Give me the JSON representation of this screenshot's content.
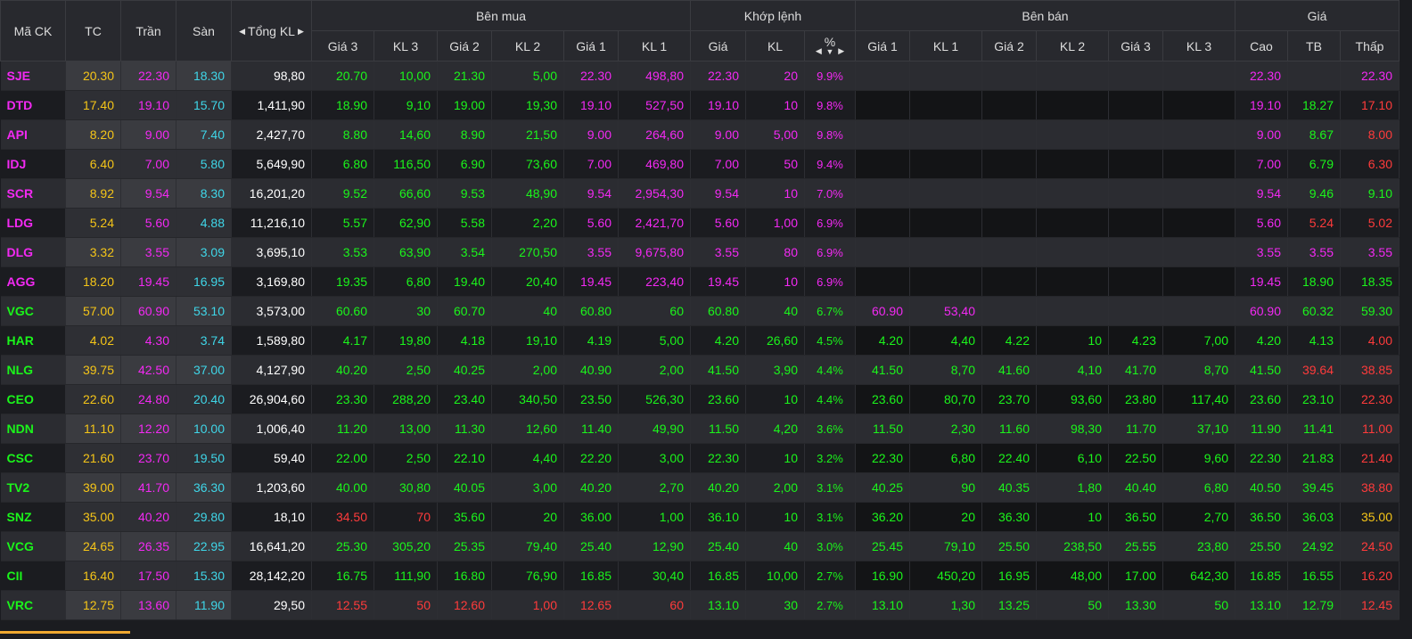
{
  "header": {
    "symbol": "Mã CK",
    "ref": "TC",
    "ceil": "Trần",
    "floor": "Sàn",
    "total_vol": "Tổng KL",
    "groups": {
      "bid": "Bên mua",
      "match": "Khớp lệnh",
      "ask": "Bên bán",
      "price": "Giá"
    },
    "bid_cols": [
      "Giá 3",
      "KL 3",
      "Giá 2",
      "KL 2",
      "Giá 1",
      "KL 1"
    ],
    "match_cols": [
      "Giá",
      "KL",
      "%"
    ],
    "ask_cols": [
      "Giá 1",
      "KL 1",
      "Giá 2",
      "KL 2",
      "Giá 3",
      "KL 3"
    ],
    "price_cols": [
      "Cao",
      "TB",
      "Thấp"
    ]
  },
  "colors": {
    "ref": "#f5c518",
    "ceil": "#f329f3",
    "floor": "#3fd6e8",
    "up": "#1bf51b",
    "down": "#ff3b3b",
    "white": "#ffffff"
  },
  "rows": [
    {
      "sym": "SJE",
      "sc": "ceil",
      "ref": "20.30",
      "ceil": "22.30",
      "floor": "18.30",
      "tot": "98,80",
      "b3": "20.70",
      "b3v": "10,00",
      "b3c": "up",
      "b2": "21.30",
      "b2v": "5,00",
      "b2c": "up",
      "b1": "22.30",
      "b1v": "498,80",
      "b1c": "ceil",
      "mp": "22.30",
      "mv": "20",
      "mpct": "9.9%",
      "mc": "ceil",
      "a1": "",
      "a1v": "",
      "a1c": "up",
      "a2": "",
      "a2v": "",
      "a2c": "up",
      "a3": "",
      "a3v": "",
      "a3c": "up",
      "hi": "22.30",
      "hic": "ceil",
      "avg": "",
      "avgc": "up",
      "lo": "22.30",
      "loc": "ceil"
    },
    {
      "sym": "DTD",
      "sc": "ceil",
      "ref": "17.40",
      "ceil": "19.10",
      "floor": "15.70",
      "tot": "1,411,90",
      "b3": "18.90",
      "b3v": "9,10",
      "b3c": "up",
      "b2": "19.00",
      "b2v": "19,30",
      "b2c": "up",
      "b1": "19.10",
      "b1v": "527,50",
      "b1c": "ceil",
      "mp": "19.10",
      "mv": "10",
      "mpct": "9.8%",
      "mc": "ceil",
      "a1": "",
      "a1v": "",
      "a1c": "up",
      "a2": "",
      "a2v": "",
      "a2c": "up",
      "a3": "",
      "a3v": "",
      "a3c": "up",
      "hi": "19.10",
      "hic": "ceil",
      "avg": "18.27",
      "avgc": "up",
      "lo": "17.10",
      "loc": "down"
    },
    {
      "sym": "API",
      "sc": "ceil",
      "ref": "8.20",
      "ceil": "9.00",
      "floor": "7.40",
      "tot": "2,427,70",
      "b3": "8.80",
      "b3v": "14,60",
      "b3c": "up",
      "b2": "8.90",
      "b2v": "21,50",
      "b2c": "up",
      "b1": "9.00",
      "b1v": "264,60",
      "b1c": "ceil",
      "mp": "9.00",
      "mv": "5,00",
      "mpct": "9.8%",
      "mc": "ceil",
      "a1": "",
      "a1v": "",
      "a1c": "up",
      "a2": "",
      "a2v": "",
      "a2c": "up",
      "a3": "",
      "a3v": "",
      "a3c": "up",
      "hi": "9.00",
      "hic": "ceil",
      "avg": "8.67",
      "avgc": "up",
      "lo": "8.00",
      "loc": "down"
    },
    {
      "sym": "IDJ",
      "sc": "ceil",
      "ref": "6.40",
      "ceil": "7.00",
      "floor": "5.80",
      "tot": "5,649,90",
      "b3": "6.80",
      "b3v": "116,50",
      "b3c": "up",
      "b2": "6.90",
      "b2v": "73,60",
      "b2c": "up",
      "b1": "7.00",
      "b1v": "469,80",
      "b1c": "ceil",
      "mp": "7.00",
      "mv": "50",
      "mpct": "9.4%",
      "mc": "ceil",
      "a1": "",
      "a1v": "",
      "a1c": "up",
      "a2": "",
      "a2v": "",
      "a2c": "up",
      "a3": "",
      "a3v": "",
      "a3c": "up",
      "hi": "7.00",
      "hic": "ceil",
      "avg": "6.79",
      "avgc": "up",
      "lo": "6.30",
      "loc": "down"
    },
    {
      "sym": "SCR",
      "sc": "ceil",
      "ref": "8.92",
      "ceil": "9.54",
      "floor": "8.30",
      "tot": "16,201,20",
      "b3": "9.52",
      "b3v": "66,60",
      "b3c": "up",
      "b2": "9.53",
      "b2v": "48,90",
      "b2c": "up",
      "b1": "9.54",
      "b1v": "2,954,30",
      "b1c": "ceil",
      "mp": "9.54",
      "mv": "10",
      "mpct": "7.0%",
      "mc": "ceil",
      "a1": "",
      "a1v": "",
      "a1c": "up",
      "a2": "",
      "a2v": "",
      "a2c": "up",
      "a3": "",
      "a3v": "",
      "a3c": "up",
      "hi": "9.54",
      "hic": "ceil",
      "avg": "9.46",
      "avgc": "up",
      "lo": "9.10",
      "loc": "up"
    },
    {
      "sym": "LDG",
      "sc": "ceil",
      "ref": "5.24",
      "ceil": "5.60",
      "floor": "4.88",
      "tot": "11,216,10",
      "b3": "5.57",
      "b3v": "62,90",
      "b3c": "up",
      "b2": "5.58",
      "b2v": "2,20",
      "b2c": "up",
      "b1": "5.60",
      "b1v": "2,421,70",
      "b1c": "ceil",
      "mp": "5.60",
      "mv": "1,00",
      "mpct": "6.9%",
      "mc": "ceil",
      "a1": "",
      "a1v": "",
      "a1c": "up",
      "a2": "",
      "a2v": "",
      "a2c": "up",
      "a3": "",
      "a3v": "",
      "a3c": "up",
      "hi": "5.60",
      "hic": "ceil",
      "avg": "5.24",
      "avgc": "down",
      "lo": "5.02",
      "loc": "down"
    },
    {
      "sym": "DLG",
      "sc": "ceil",
      "ref": "3.32",
      "ceil": "3.55",
      "floor": "3.09",
      "tot": "3,695,10",
      "b3": "3.53",
      "b3v": "63,90",
      "b3c": "up",
      "b2": "3.54",
      "b2v": "270,50",
      "b2c": "up",
      "b1": "3.55",
      "b1v": "9,675,80",
      "b1c": "ceil",
      "mp": "3.55",
      "mv": "80",
      "mpct": "6.9%",
      "mc": "ceil",
      "a1": "",
      "a1v": "",
      "a1c": "up",
      "a2": "",
      "a2v": "",
      "a2c": "up",
      "a3": "",
      "a3v": "",
      "a3c": "up",
      "hi": "3.55",
      "hic": "ceil",
      "avg": "3.55",
      "avgc": "ceil",
      "lo": "3.55",
      "loc": "ceil"
    },
    {
      "sym": "AGG",
      "sc": "ceil",
      "ref": "18.20",
      "ceil": "19.45",
      "floor": "16.95",
      "tot": "3,169,80",
      "b3": "19.35",
      "b3v": "6,80",
      "b3c": "up",
      "b2": "19.40",
      "b2v": "20,40",
      "b2c": "up",
      "b1": "19.45",
      "b1v": "223,40",
      "b1c": "ceil",
      "mp": "19.45",
      "mv": "10",
      "mpct": "6.9%",
      "mc": "ceil",
      "a1": "",
      "a1v": "",
      "a1c": "up",
      "a2": "",
      "a2v": "",
      "a2c": "up",
      "a3": "",
      "a3v": "",
      "a3c": "up",
      "hi": "19.45",
      "hic": "ceil",
      "avg": "18.90",
      "avgc": "up",
      "lo": "18.35",
      "loc": "up"
    },
    {
      "sym": "VGC",
      "sc": "up",
      "ref": "57.00",
      "ceil": "60.90",
      "floor": "53.10",
      "tot": "3,573,00",
      "b3": "60.60",
      "b3v": "30",
      "b3c": "up",
      "b2": "60.70",
      "b2v": "40",
      "b2c": "up",
      "b1": "60.80",
      "b1v": "60",
      "b1c": "up",
      "mp": "60.80",
      "mv": "40",
      "mpct": "6.7%",
      "mc": "up",
      "a1": "60.90",
      "a1v": "53,40",
      "a1c": "ceil",
      "a2": "",
      "a2v": "",
      "a2c": "up",
      "a3": "",
      "a3v": "",
      "a3c": "up",
      "hi": "60.90",
      "hic": "ceil",
      "avg": "60.32",
      "avgc": "up",
      "lo": "59.30",
      "loc": "up"
    },
    {
      "sym": "HAR",
      "sc": "up",
      "ref": "4.02",
      "ceil": "4.30",
      "floor": "3.74",
      "tot": "1,589,80",
      "b3": "4.17",
      "b3v": "19,80",
      "b3c": "up",
      "b2": "4.18",
      "b2v": "19,10",
      "b2c": "up",
      "b1": "4.19",
      "b1v": "5,00",
      "b1c": "up",
      "mp": "4.20",
      "mv": "26,60",
      "mpct": "4.5%",
      "mc": "up",
      "a1": "4.20",
      "a1v": "4,40",
      "a1c": "up",
      "a2": "4.22",
      "a2v": "10",
      "a2c": "up",
      "a3": "4.23",
      "a3v": "7,00",
      "a3c": "up",
      "hi": "4.20",
      "hic": "up",
      "avg": "4.13",
      "avgc": "up",
      "lo": "4.00",
      "loc": "down"
    },
    {
      "sym": "NLG",
      "sc": "up",
      "ref": "39.75",
      "ceil": "42.50",
      "floor": "37.00",
      "tot": "4,127,90",
      "b3": "40.20",
      "b3v": "2,50",
      "b3c": "up",
      "b2": "40.25",
      "b2v": "2,00",
      "b2c": "up",
      "b1": "40.90",
      "b1v": "2,00",
      "b1c": "up",
      "mp": "41.50",
      "mv": "3,90",
      "mpct": "4.4%",
      "mc": "up",
      "a1": "41.50",
      "a1v": "8,70",
      "a1c": "up",
      "a2": "41.60",
      "a2v": "4,10",
      "a2c": "up",
      "a3": "41.70",
      "a3v": "8,70",
      "a3c": "up",
      "hi": "41.50",
      "hic": "up",
      "avg": "39.64",
      "avgc": "down",
      "lo": "38.85",
      "loc": "down"
    },
    {
      "sym": "CEO",
      "sc": "up",
      "ref": "22.60",
      "ceil": "24.80",
      "floor": "20.40",
      "tot": "26,904,60",
      "b3": "23.30",
      "b3v": "288,20",
      "b3c": "up",
      "b2": "23.40",
      "b2v": "340,50",
      "b2c": "up",
      "b1": "23.50",
      "b1v": "526,30",
      "b1c": "up",
      "mp": "23.60",
      "mv": "10",
      "mpct": "4.4%",
      "mc": "up",
      "a1": "23.60",
      "a1v": "80,70",
      "a1c": "up",
      "a2": "23.70",
      "a2v": "93,60",
      "a2c": "up",
      "a3": "23.80",
      "a3v": "117,40",
      "a3c": "up",
      "hi": "23.60",
      "hic": "up",
      "avg": "23.10",
      "avgc": "up",
      "lo": "22.30",
      "loc": "down"
    },
    {
      "sym": "NDN",
      "sc": "up",
      "ref": "11.10",
      "ceil": "12.20",
      "floor": "10.00",
      "tot": "1,006,40",
      "b3": "11.20",
      "b3v": "13,00",
      "b3c": "up",
      "b2": "11.30",
      "b2v": "12,60",
      "b2c": "up",
      "b1": "11.40",
      "b1v": "49,90",
      "b1c": "up",
      "mp": "11.50",
      "mv": "4,20",
      "mpct": "3.6%",
      "mc": "up",
      "a1": "11.50",
      "a1v": "2,30",
      "a1c": "up",
      "a2": "11.60",
      "a2v": "98,30",
      "a2c": "up",
      "a3": "11.70",
      "a3v": "37,10",
      "a3c": "up",
      "hi": "11.90",
      "hic": "up",
      "avg": "11.41",
      "avgc": "up",
      "lo": "11.00",
      "loc": "down"
    },
    {
      "sym": "CSC",
      "sc": "up",
      "ref": "21.60",
      "ceil": "23.70",
      "floor": "19.50",
      "tot": "59,40",
      "b3": "22.00",
      "b3v": "2,50",
      "b3c": "up",
      "b2": "22.10",
      "b2v": "4,40",
      "b2c": "up",
      "b1": "22.20",
      "b1v": "3,00",
      "b1c": "up",
      "mp": "22.30",
      "mv": "10",
      "mpct": "3.2%",
      "mc": "up",
      "a1": "22.30",
      "a1v": "6,80",
      "a1c": "up",
      "a2": "22.40",
      "a2v": "6,10",
      "a2c": "up",
      "a3": "22.50",
      "a3v": "9,60",
      "a3c": "up",
      "hi": "22.30",
      "hic": "up",
      "avg": "21.83",
      "avgc": "up",
      "lo": "21.40",
      "loc": "down"
    },
    {
      "sym": "TV2",
      "sc": "up",
      "ref": "39.00",
      "ceil": "41.70",
      "floor": "36.30",
      "tot": "1,203,60",
      "b3": "40.00",
      "b3v": "30,80",
      "b3c": "up",
      "b2": "40.05",
      "b2v": "3,00",
      "b2c": "up",
      "b1": "40.20",
      "b1v": "2,70",
      "b1c": "up",
      "mp": "40.20",
      "mv": "2,00",
      "mpct": "3.1%",
      "mc": "up",
      "a1": "40.25",
      "a1v": "90",
      "a1c": "up",
      "a2": "40.35",
      "a2v": "1,80",
      "a2c": "up",
      "a3": "40.40",
      "a3v": "6,80",
      "a3c": "up",
      "hi": "40.50",
      "hic": "up",
      "avg": "39.45",
      "avgc": "up",
      "lo": "38.80",
      "loc": "down"
    },
    {
      "sym": "SNZ",
      "sc": "up",
      "ref": "35.00",
      "ceil": "40.20",
      "floor": "29.80",
      "tot": "18,10",
      "b3": "34.50",
      "b3v": "70",
      "b3c": "down",
      "b2": "35.60",
      "b2v": "20",
      "b2c": "up",
      "b1": "36.00",
      "b1v": "1,00",
      "b1c": "up",
      "mp": "36.10",
      "mv": "10",
      "mpct": "3.1%",
      "mc": "up",
      "a1": "36.20",
      "a1v": "20",
      "a1c": "up",
      "a2": "36.30",
      "a2v": "10",
      "a2c": "up",
      "a3": "36.50",
      "a3v": "2,70",
      "a3c": "up",
      "hi": "36.50",
      "hic": "up",
      "avg": "36.03",
      "avgc": "up",
      "lo": "35.00",
      "loc": "ref"
    },
    {
      "sym": "VCG",
      "sc": "up",
      "ref": "24.65",
      "ceil": "26.35",
      "floor": "22.95",
      "tot": "16,641,20",
      "b3": "25.30",
      "b3v": "305,20",
      "b3c": "up",
      "b2": "25.35",
      "b2v": "79,40",
      "b2c": "up",
      "b1": "25.40",
      "b1v": "12,90",
      "b1c": "up",
      "mp": "25.40",
      "mv": "40",
      "mpct": "3.0%",
      "mc": "up",
      "a1": "25.45",
      "a1v": "79,10",
      "a1c": "up",
      "a2": "25.50",
      "a2v": "238,50",
      "a2c": "up",
      "a3": "25.55",
      "a3v": "23,80",
      "a3c": "up",
      "hi": "25.50",
      "hic": "up",
      "avg": "24.92",
      "avgc": "up",
      "lo": "24.50",
      "loc": "down"
    },
    {
      "sym": "CII",
      "sc": "up",
      "ref": "16.40",
      "ceil": "17.50",
      "floor": "15.30",
      "tot": "28,142,20",
      "b3": "16.75",
      "b3v": "111,90",
      "b3c": "up",
      "b2": "16.80",
      "b2v": "76,90",
      "b2c": "up",
      "b1": "16.85",
      "b1v": "30,40",
      "b1c": "up",
      "mp": "16.85",
      "mv": "10,00",
      "mpct": "2.7%",
      "mc": "up",
      "a1": "16.90",
      "a1v": "450,20",
      "a1c": "up",
      "a2": "16.95",
      "a2v": "48,00",
      "a2c": "up",
      "a3": "17.00",
      "a3v": "642,30",
      "a3c": "up",
      "hi": "16.85",
      "hic": "up",
      "avg": "16.55",
      "avgc": "up",
      "lo": "16.20",
      "loc": "down"
    },
    {
      "sym": "VRC",
      "sc": "up",
      "ref": "12.75",
      "ceil": "13.60",
      "floor": "11.90",
      "tot": "29,50",
      "b3": "12.55",
      "b3v": "50",
      "b3c": "down",
      "b2": "12.60",
      "b2v": "1,00",
      "b2c": "down",
      "b1": "12.65",
      "b1v": "60",
      "b1c": "down",
      "mp": "13.10",
      "mv": "30",
      "mpct": "2.7%",
      "mc": "up",
      "a1": "13.10",
      "a1v": "1,30",
      "a1c": "up",
      "a2": "13.25",
      "a2v": "50",
      "a2c": "up",
      "a3": "13.30",
      "a3v": "50",
      "a3c": "up",
      "hi": "13.10",
      "hic": "up",
      "avg": "12.79",
      "avgc": "up",
      "lo": "12.45",
      "loc": "down"
    }
  ]
}
